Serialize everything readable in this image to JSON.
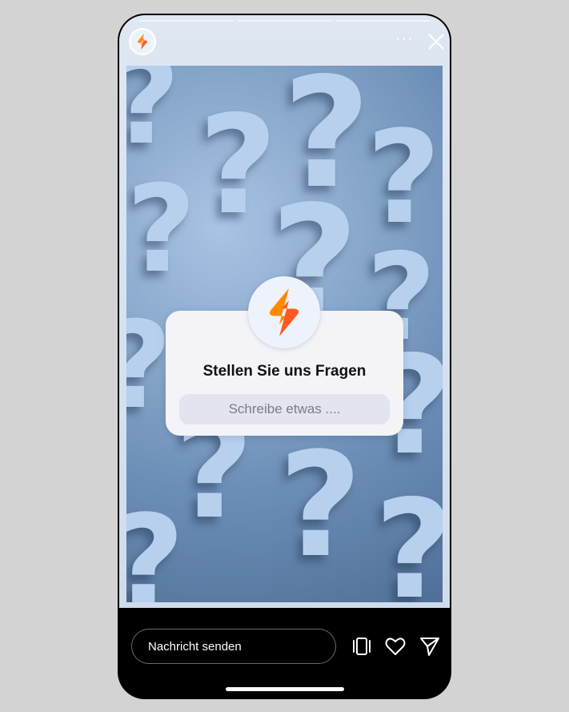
{
  "card": {
    "title": "Stellen Sie uns Fragen",
    "input_placeholder": "Schreibe etwas ...."
  },
  "bottom_bar": {
    "message_placeholder": "Nachricht senden"
  },
  "header": {
    "more_label": "···"
  },
  "icons": {
    "brand": "brand-logo-icon",
    "more": "more-options-icon",
    "close": "close-icon",
    "stack": "stack-icon",
    "like": "heart-icon",
    "share": "send-icon"
  },
  "colors": {
    "brand_orange": "#ff6a00",
    "card_bg": "#f3f3f8",
    "input_bg": "#e2e4f0"
  }
}
